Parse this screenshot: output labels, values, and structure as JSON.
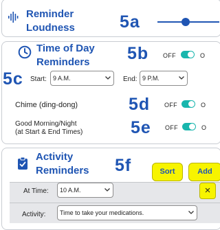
{
  "loudness": {
    "title_line1": "Reminder",
    "title_line2": "Loudness",
    "callout": "5a",
    "level": 0.45
  },
  "time_of_day": {
    "title_line1": "Time of Day",
    "title_line2": "Reminders",
    "callout_toggle": "5b",
    "toggle_off_label": "OFF",
    "toggle_on_label": "O",
    "callout_times": "5c",
    "start_label": "Start:",
    "start_value": "9 A.M.",
    "end_label": "End:",
    "end_value": "9 P.M.",
    "chime_label": "Chime (ding-dong)",
    "chime_callout": "5d",
    "chime_off": "OFF",
    "chime_on": "O",
    "goodmorning_line1": "Good Morning/Night",
    "goodmorning_line2": "(at Start & End Times)",
    "goodmorning_callout": "5e",
    "goodmorning_off": "OFF",
    "goodmorning_on": "O"
  },
  "activity": {
    "title_line1": "Activity",
    "title_line2": "Reminders",
    "callout": "5f",
    "sort_label": "Sort",
    "add_label": "Add",
    "at_time_label": "At Time:",
    "at_time_value": "10 A.M.",
    "remove_glyph": "×",
    "activity_label": "Activity:",
    "activity_value": "Time to take your medications."
  },
  "colors": {
    "accent": "#1f55b3",
    "toggle_on": "#18b6ad",
    "button_yellow": "#f7f400"
  }
}
